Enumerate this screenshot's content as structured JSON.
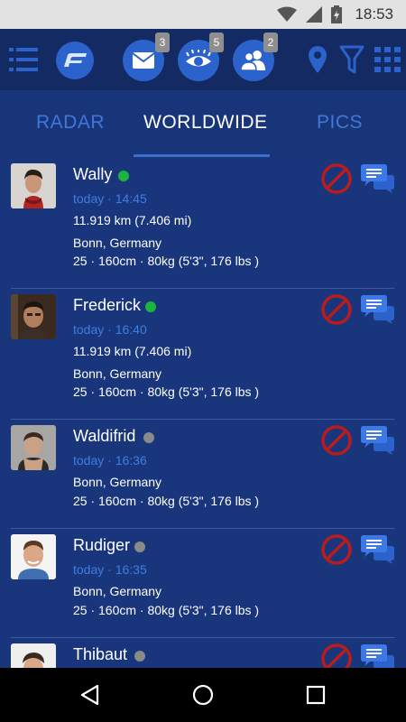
{
  "status": {
    "time": "18:53"
  },
  "header": {
    "badges": {
      "messages": "3",
      "viewers": "5",
      "friends": "2"
    }
  },
  "tabs": [
    {
      "label": "RADAR"
    },
    {
      "label": "WORLDWIDE"
    },
    {
      "label": "PICS"
    }
  ],
  "users": [
    {
      "name": "Wally",
      "online": true,
      "time": "today · 14:45",
      "distance": "11.919 km (7.406 mi)",
      "location": "Bonn, Germany",
      "stats": "25 · 160cm · 80kg (5'3\", 176 lbs )"
    },
    {
      "name": "Frederick",
      "online": true,
      "time": "today · 16:40",
      "distance": "11.919 km (7.406 mi)",
      "location": "Bonn, Germany",
      "stats": "25 · 160cm · 80kg (5'3\", 176 lbs )"
    },
    {
      "name": "Waldifrid",
      "online": false,
      "time": "today · 16:36",
      "location": "Bonn, Germany",
      "stats": "25 · 160cm · 80kg (5'3\", 176 lbs )"
    },
    {
      "name": "Rudiger",
      "online": false,
      "time": "today · 16:35",
      "location": "Bonn, Germany",
      "stats": "25 · 160cm · 80kg (5'3\", 176 lbs )"
    },
    {
      "name": "Thibaut",
      "online": false
    }
  ],
  "colors": {
    "background": "#19357c",
    "header": "#142a63",
    "accent": "#2c62cc",
    "online": "#1bb53d",
    "offline": "#8a8a8a",
    "block": "#b81c1c"
  },
  "icons": [
    "menu-icon",
    "app-logo-icon",
    "envelope-icon",
    "eye-icon",
    "friends-icon",
    "location-pin-icon",
    "filter-icon",
    "grid-icon",
    "block-icon",
    "chat-icon",
    "back-icon",
    "home-icon",
    "recents-icon"
  ]
}
